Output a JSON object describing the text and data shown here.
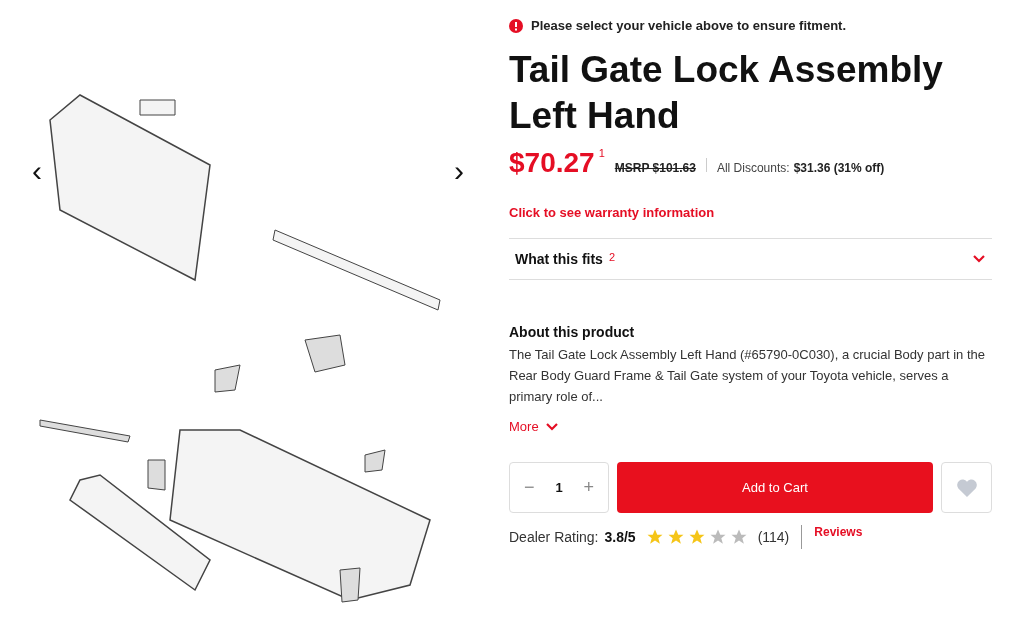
{
  "gallery": {
    "prev": "‹",
    "next": "›"
  },
  "product": {
    "alert": "Please select your vehicle above to ensure fitment.",
    "title": "Tail Gate Lock Assembly Left Hand",
    "price": "$70.27",
    "price_note": "1",
    "msrp": "MSRP $101.63",
    "discounts_label": "All Discounts:",
    "discounts_value": "$31.36 (31% off)",
    "warranty_link": "Click to see warranty information",
    "fits": {
      "label": "What this fits",
      "note": "2",
      "expanded": false
    },
    "about": {
      "heading": "About this product",
      "text": "The Tail Gate Lock Assembly Left Hand (#65790-0C030), a crucial Body part in the Rear Body Guard Frame & Tail Gate system of your Toyota vehicle, serves a primary role of...",
      "more": "More"
    },
    "quantity": {
      "minus": "−",
      "value": "1",
      "plus": "+"
    },
    "add_to_cart": "Add to Cart",
    "rating": {
      "label": "Dealer Rating:",
      "value": "3.8/5",
      "stars": 3,
      "count": "(114)",
      "reviews": "Reviews"
    }
  }
}
